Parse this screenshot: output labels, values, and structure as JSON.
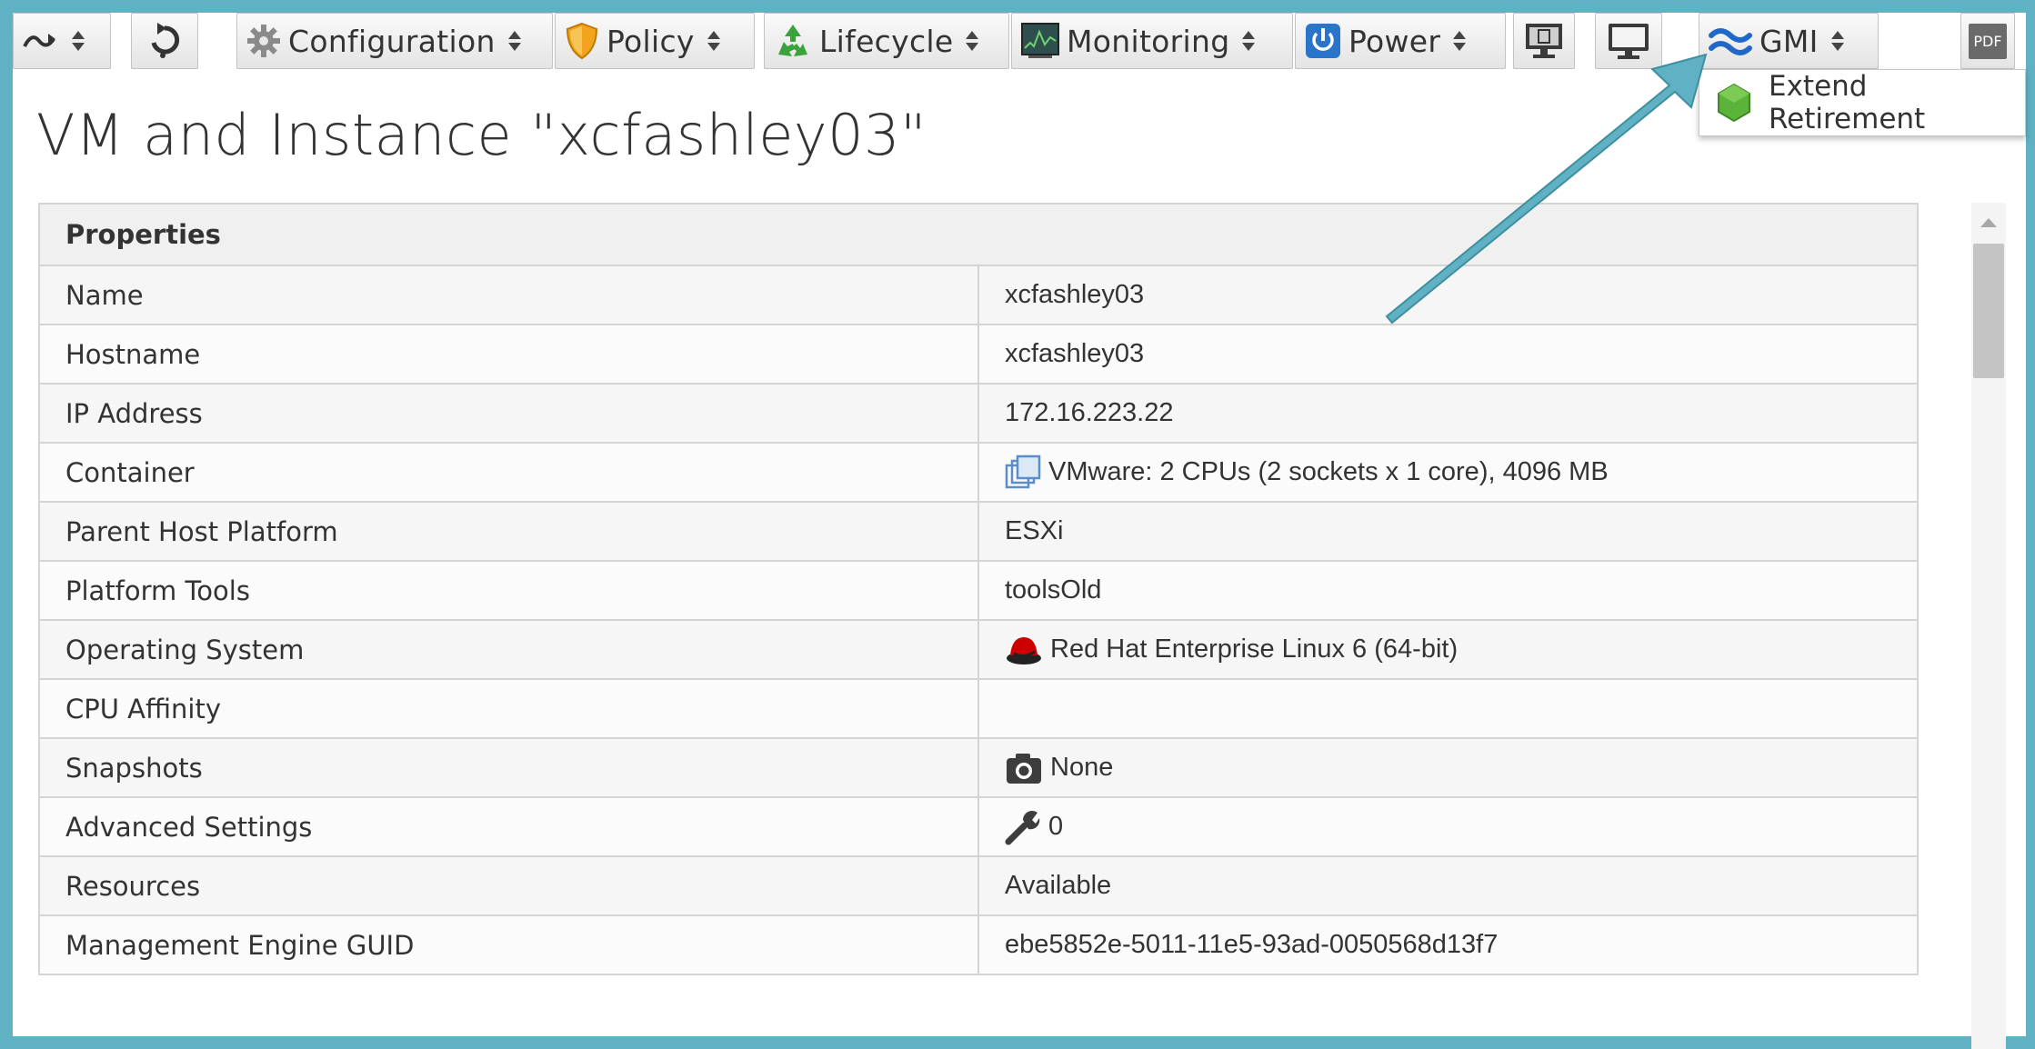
{
  "toolbar": {
    "history_label": "",
    "configuration": "Configuration",
    "policy": "Policy",
    "lifecycle": "Lifecycle",
    "monitoring": "Monitoring",
    "power": "Power",
    "gmi": "GMI",
    "pdf": "PDF"
  },
  "gmi_menu": {
    "items": [
      {
        "label": "Extend Retirement"
      }
    ]
  },
  "page": {
    "title": "VM and Instance \"xcfashley03\""
  },
  "properties": {
    "header": "Properties",
    "rows": [
      {
        "key": "Name",
        "value": "xcfashley03"
      },
      {
        "key": "Hostname",
        "value": "xcfashley03"
      },
      {
        "key": "IP Address",
        "value": "172.16.223.22"
      },
      {
        "key": "Container",
        "value": "VMware: 2 CPUs (2 sockets x 1 core), 4096 MB",
        "icon": "vmware-container-icon"
      },
      {
        "key": "Parent Host Platform",
        "value": "ESXi"
      },
      {
        "key": "Platform Tools",
        "value": "toolsOld"
      },
      {
        "key": "Operating System",
        "value": "Red Hat Enterprise Linux 6 (64-bit)",
        "icon": "redhat-icon"
      },
      {
        "key": "CPU Affinity",
        "value": ""
      },
      {
        "key": "Snapshots",
        "value": "None",
        "icon": "camera-icon"
      },
      {
        "key": "Advanced Settings",
        "value": "0",
        "icon": "wrench-icon"
      },
      {
        "key": "Resources",
        "value": "Available"
      },
      {
        "key": "Management Engine GUID",
        "value": "ebe5852e-5011-11e5-93ad-0050568d13f7"
      }
    ]
  },
  "colors": {
    "frame": "#5fb1c3",
    "arrow": "#5fb1c3",
    "gmi_icon": "#1f67c9",
    "extend_hex": "#5cb33a"
  }
}
